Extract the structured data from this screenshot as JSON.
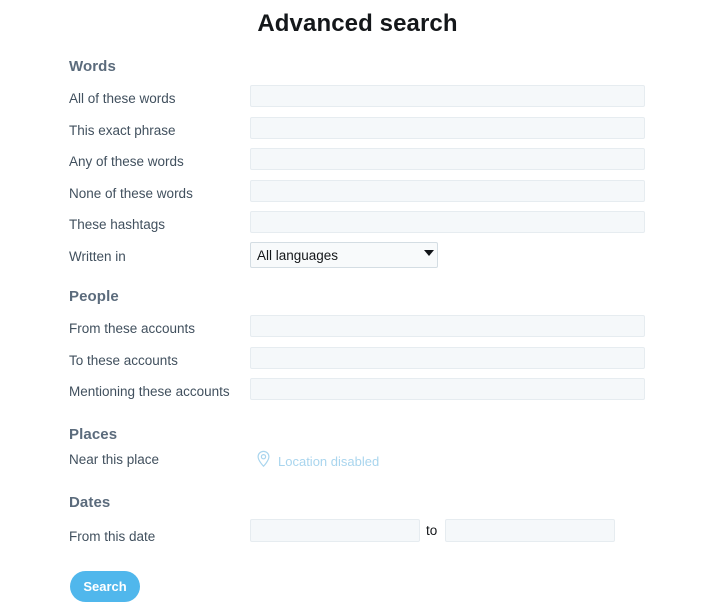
{
  "page": {
    "title": "Advanced search"
  },
  "sections": {
    "words": {
      "header": "Words",
      "fields": [
        {
          "label": "All of these words",
          "value": "",
          "placeholder": ""
        },
        {
          "label": "This exact phrase",
          "value": "",
          "placeholder": ""
        },
        {
          "label": "Any of these words",
          "value": "",
          "placeholder": ""
        },
        {
          "label": "None of these words",
          "value": "",
          "placeholder": ""
        },
        {
          "label": "These hashtags",
          "value": "",
          "placeholder": ""
        }
      ],
      "language": {
        "label": "Written in",
        "selected": "All languages",
        "options": [
          "All languages"
        ],
        "arrow_icon": "chevron-down-icon"
      }
    },
    "people": {
      "header": "People",
      "fields": [
        {
          "label": "From these accounts",
          "value": "",
          "placeholder": ""
        },
        {
          "label": "To these accounts",
          "value": "",
          "placeholder": ""
        },
        {
          "label": "Mentioning these accounts",
          "value": "",
          "placeholder": ""
        }
      ]
    },
    "places": {
      "header": "Places",
      "label": "Near this place",
      "status_text": "Location disabled",
      "status_icon": "map-pin-icon",
      "status_color": "#a9d5ee"
    },
    "dates": {
      "header": "Dates",
      "label": "From this date",
      "from_value": "",
      "from_placeholder": "",
      "separator": "to",
      "until_value": "",
      "until_placeholder": ""
    }
  },
  "actions": {
    "search_label": "Search",
    "search_color": "#50b7ec"
  }
}
